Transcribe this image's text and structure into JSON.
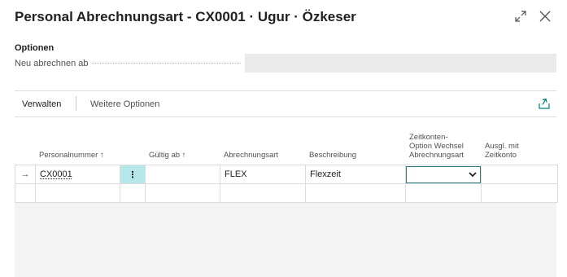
{
  "window": {
    "title": "Personal Abrechnungsart - CX0001 · Ugur · Özkeser",
    "expand_icon": "expand-arrows-icon",
    "close_icon": "close-icon"
  },
  "options": {
    "section_title": "Optionen",
    "field_label": "Neu abrechnen ab",
    "field_value": ""
  },
  "actions": {
    "verwalten": "Verwalten",
    "weitere": "Weitere Optionen",
    "share_icon": "share-icon"
  },
  "grid": {
    "columns": [
      {
        "label": "Personalnummer ↑"
      },
      {
        "label": "Gültig ab ↑"
      },
      {
        "label": "Abrechnungsart"
      },
      {
        "label": "Beschreibung"
      },
      {
        "label": "Zeitkonten-Option Wechsel Abrechnungsart",
        "lines": [
          "Zeitkonten-",
          "Option Wechsel",
          "Abrechnungsart"
        ]
      },
      {
        "label": "Ausgl. mit Zeitkonto",
        "lines": [
          "Ausgl. mit",
          "Zeitkonto"
        ]
      }
    ],
    "row": {
      "arrow": "→",
      "menu": "⋮",
      "personalnummer": "CX0001",
      "gueltig_ab": "",
      "abrechnungsart": "FLEX",
      "beschreibung": "Flexzeit",
      "zeitkonten_option": "",
      "ausgleich": ""
    }
  }
}
